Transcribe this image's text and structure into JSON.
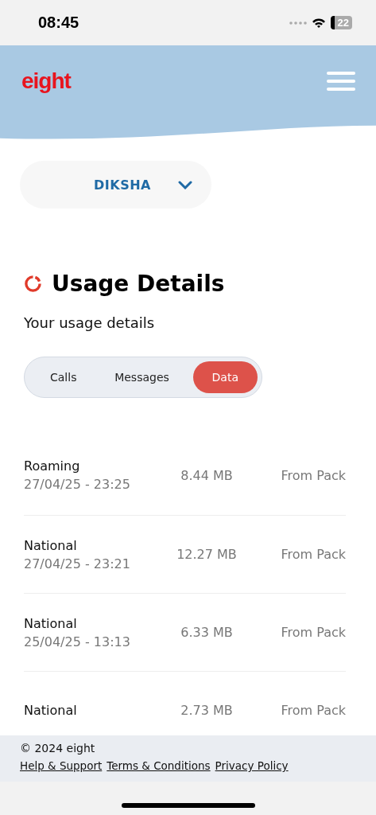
{
  "status_bar": {
    "time": "08:45",
    "battery": "22"
  },
  "header": {
    "logo": "eight"
  },
  "account_selector": {
    "value": "DIKSHA"
  },
  "title": "Usage Details",
  "subtitle": "Your usage details",
  "tabs": [
    {
      "label": "Calls",
      "selected": false
    },
    {
      "label": "Messages",
      "selected": false
    },
    {
      "label": "Data",
      "selected": true
    }
  ],
  "usage": [
    {
      "type": "Roaming",
      "date": "27/04/25 - 23:25",
      "amount": "8.44 MB",
      "source": "From Pack"
    },
    {
      "type": "National",
      "date": "27/04/25 - 23:21",
      "amount": "12.27 MB",
      "source": "From Pack"
    },
    {
      "type": "National",
      "date": "25/04/25 - 13:13",
      "amount": "6.33 MB",
      "source": "From Pack"
    },
    {
      "type": "National",
      "amount": "2.73 MB",
      "source": "From Pack"
    }
  ],
  "footer": {
    "copyright": "© 2024 eight",
    "links": [
      "Help & Support",
      "Terms & Conditions",
      "Privacy Policy"
    ]
  }
}
